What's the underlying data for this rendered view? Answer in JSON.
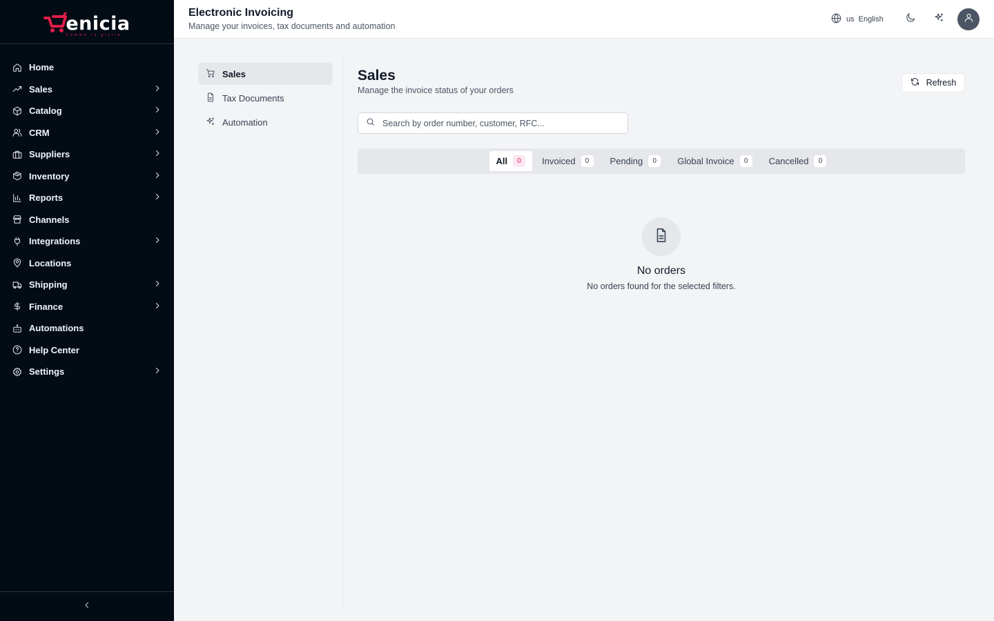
{
  "brand": {
    "name": "enicia",
    "tagline": "Comme la gloire",
    "accent": "#e11d48"
  },
  "sidebar": {
    "items": [
      {
        "label": "Home",
        "icon": "home-icon",
        "expandable": false
      },
      {
        "label": "Sales",
        "icon": "trending-up-icon",
        "expandable": true
      },
      {
        "label": "Catalog",
        "icon": "package-icon",
        "expandable": true
      },
      {
        "label": "CRM",
        "icon": "users-icon",
        "expandable": true
      },
      {
        "label": "Suppliers",
        "icon": "briefcase-icon",
        "expandable": true
      },
      {
        "label": "Inventory",
        "icon": "box-icon",
        "expandable": true
      },
      {
        "label": "Reports",
        "icon": "bar-chart-icon",
        "expandable": true
      },
      {
        "label": "Channels",
        "icon": "store-icon",
        "expandable": false
      },
      {
        "label": "Integrations",
        "icon": "plug-icon",
        "expandable": true
      },
      {
        "label": "Locations",
        "icon": "map-pin-icon",
        "expandable": false
      },
      {
        "label": "Shipping",
        "icon": "truck-icon",
        "expandable": true
      },
      {
        "label": "Finance",
        "icon": "dollar-icon",
        "expandable": true
      },
      {
        "label": "Automations",
        "icon": "bot-icon",
        "expandable": false
      },
      {
        "label": "Help Center",
        "icon": "help-circle-icon",
        "expandable": false
      },
      {
        "label": "Settings",
        "icon": "gear-icon",
        "expandable": true
      }
    ]
  },
  "header": {
    "title": "Electronic Invoicing",
    "subtitle": "Manage your invoices, tax documents and automation",
    "language_code": "us",
    "language": "English"
  },
  "subnav": {
    "items": [
      {
        "label": "Sales",
        "icon": "cart-icon",
        "active": true
      },
      {
        "label": "Tax Documents",
        "icon": "file-icon",
        "active": false
      },
      {
        "label": "Automation",
        "icon": "sparkles-icon",
        "active": false
      }
    ]
  },
  "main": {
    "title": "Sales",
    "subtitle": "Manage the invoice status of your orders",
    "refresh_label": "Refresh",
    "search_placeholder": "Search by order number, customer, RFC...",
    "search_value": "",
    "tabs": [
      {
        "label": "All",
        "count": "0",
        "active": true
      },
      {
        "label": "Invoiced",
        "count": "0",
        "active": false
      },
      {
        "label": "Pending",
        "count": "0",
        "active": false
      },
      {
        "label": "Global Invoice",
        "count": "0",
        "active": false
      },
      {
        "label": "Cancelled",
        "count": "0",
        "active": false
      }
    ],
    "empty": {
      "title": "No orders",
      "message": "No orders found for the selected filters."
    }
  }
}
